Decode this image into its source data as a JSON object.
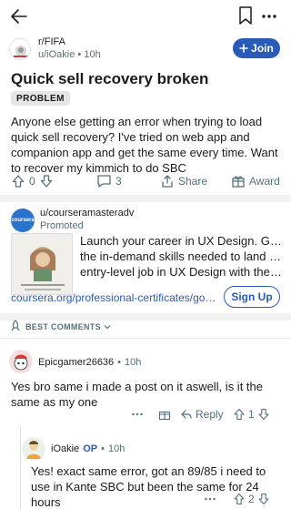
{
  "topbar": {
    "back_icon": "arrow-left-icon",
    "bookmark_icon": "bookmark-icon",
    "more_icon": "more-horizontal-icon"
  },
  "post": {
    "subreddit": "r/FIFA",
    "author": "u/iOakie",
    "time": "10h",
    "join_label": "Join",
    "title": "Quick sell recovery broken",
    "flair": "PROBLEM",
    "body": "Anyone else getting an error when trying to load quick sell recovery? I've tried on web app and companion app and get the same every time. Want to recover my kimmich to do SBC",
    "votes": "0",
    "comments": "3",
    "share_label": "Share",
    "award_label": "Award"
  },
  "ad": {
    "advertiser": "u/courseramasteradv",
    "promoted_label": "Promoted",
    "logo_text": "coursera",
    "text_lines": [
      "Launch your career in UX Design. Gain",
      "the in-demand skills needed to land an",
      "entry-level job in UX Design with the Go..."
    ],
    "url": "coursera.org/professional-certificates/google-u...",
    "cta_label": "Sign Up"
  },
  "sort": {
    "label": "BEST COMMENTS"
  },
  "comments": [
    {
      "author": "Epicgamer26636",
      "time": "10h",
      "body": "Yes bro same i made a post on it aswell, is it the same as my one",
      "reply_label": "Reply",
      "votes": "1"
    },
    {
      "author": "iOakie",
      "op_label": "OP",
      "time": "10h",
      "body": "Yes! exact same error, got an 89/85 i need to use in Kante SBC but been the same for 24 hours",
      "votes": "2"
    }
  ],
  "colors": {
    "accent": "#2b5bb8",
    "muted": "#576f76",
    "divider": "#f2f2f2"
  }
}
